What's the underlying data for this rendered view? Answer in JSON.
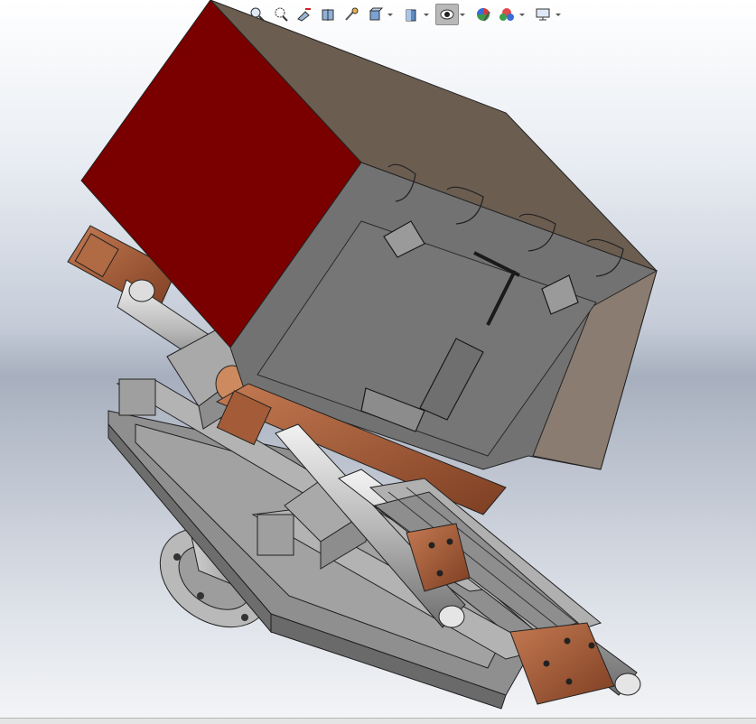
{
  "toolbar": {
    "items": [
      {
        "name": "zoom-to-fit-icon",
        "dropdown": false
      },
      {
        "name": "zoom-to-area-icon",
        "dropdown": false
      },
      {
        "name": "previous-view-icon",
        "dropdown": false
      },
      {
        "name": "section-view-icon",
        "dropdown": false
      },
      {
        "name": "dynamic-annotation-icon",
        "dropdown": false
      },
      {
        "name": "view-orientation-icon",
        "dropdown": true
      },
      {
        "name": "display-style-icon",
        "dropdown": true
      },
      {
        "name": "hide-show-items-icon",
        "dropdown": true,
        "active": true
      },
      {
        "name": "edit-appearance-icon",
        "dropdown": false
      },
      {
        "name": "apply-scene-icon",
        "dropdown": true
      },
      {
        "name": "view-settings-icon",
        "dropdown": true
      }
    ]
  },
  "colors": {
    "housing_dark_red": "#7a0000",
    "housing_top_brown": "#6b5d50",
    "housing_face_gray": "#6f6f6f",
    "housing_side_tan": "#8a7c70",
    "bracket_copper": "#9a5332",
    "rod_silver": "#c8c8c8",
    "frame_gray": "#8c8c8c",
    "background_top": "#ffffff",
    "background_mid": "#a7afbe"
  }
}
